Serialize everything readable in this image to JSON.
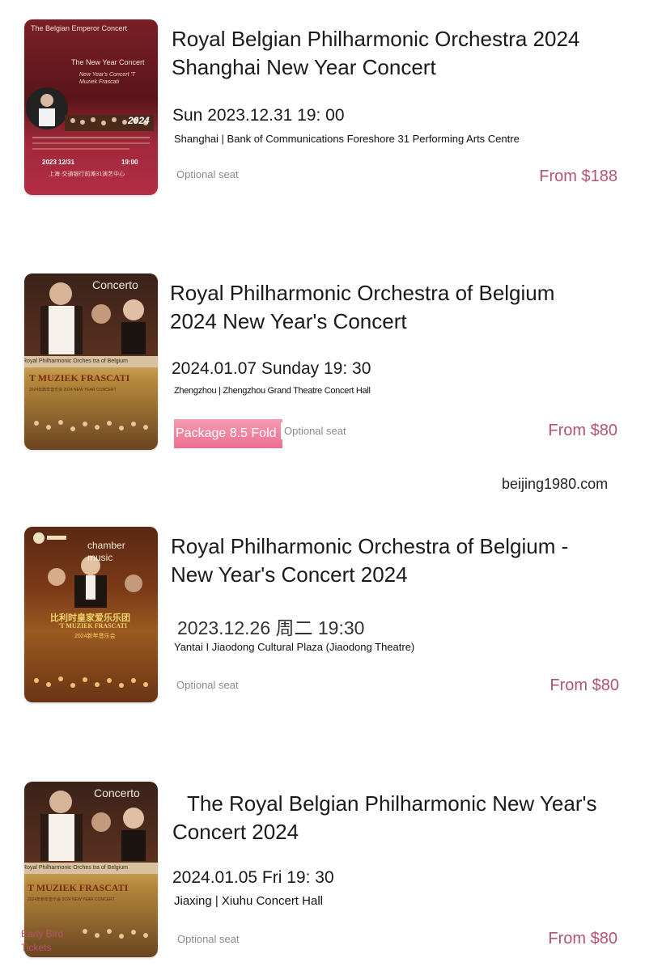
{
  "watermark": "beijing1980.com",
  "colors": {
    "price": "#b5536e",
    "promo": "#ec6f92",
    "seat_tag": "#8a8a8a"
  },
  "events": [
    {
      "poster": {
        "corner_label": "The Belgian Emperor Concert",
        "subtitle": "The New Year Concert",
        "year": "2024",
        "script": "New Year's Concert 'T Muziek Frascati",
        "date_text": "2023 12/31",
        "time_text": "19:00",
        "footer": "上海·交通银行前滩31演艺中心",
        "icon": "orchestra-poster"
      },
      "title": "Royal Belgian Philharmonic Orchestra 2024 Shanghai New Year Concert",
      "datetime": "Sun 2023.12.31 19: 00",
      "venue": "Shanghai | Bank of Communications Foreshore 31 Performing Arts Centre",
      "seat_tag": "Optional seat",
      "price": "From $188"
    },
    {
      "poster": {
        "category": "Concerto",
        "band_text": "Royal Philharmonic Orches tra of Belgium",
        "muziek": "T MUZIEK FRASCATI",
        "small": "2024年新年音乐会 2024 NEW YEAR CONCERT",
        "icon": "orchestra-poster"
      },
      "title": "Royal Philharmonic Orchestra of Belgium 2024 New Year's Concert",
      "datetime": "2024.01.07 Sunday 19: 30",
      "venue": "Zhengzhou | Zhengzhou Grand Theatre Concert Hall",
      "promo_tag": "Package 8.5 Fold",
      "seat_tag": "Optional seat",
      "price": "From $80"
    },
    {
      "poster": {
        "category": "chamber music",
        "cn_title": "比利时皇家爱乐乐团",
        "muziek": "'T MUZIEK FRASCATI",
        "cn_sub": "2024新年音乐会",
        "icon": "orchestra-poster"
      },
      "title": "Royal Philharmonic Orchestra of Belgium - New Year's Concert 2024",
      "datetime": "2023.12.26 周二 19:30",
      "venue": "Yantai I Jiaodong Cultural Plaza (Jiaodong Theatre)",
      "seat_tag": "Optional seat",
      "price": "From $80"
    },
    {
      "poster": {
        "category": "Concerto",
        "band_text": "Royal Philharmonic Orches tra of Belgium",
        "muziek": "T MUZIEK FRASCATI",
        "small": "2024年新年音乐会 2024 NEW YEAR CONCERT",
        "badge": "Early Bird Tickets",
        "icon": "orchestra-poster"
      },
      "title": "The Royal Belgian Philharmonic New Year's Concert 2024",
      "datetime": "2024.01.05 Fri 19: 30",
      "venue": "Jiaxing | Xiuhu Concert Hall",
      "seat_tag": "Optional seat",
      "price": "From $80"
    }
  ]
}
